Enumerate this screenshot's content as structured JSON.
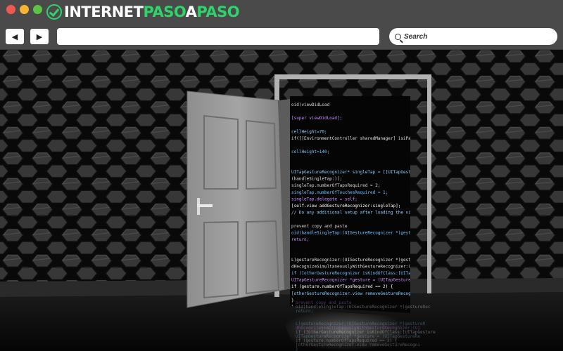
{
  "browser": {
    "logo_part1": "INTERNET",
    "logo_part2": "PASO",
    "logo_part3": "A",
    "logo_part4": "PASO",
    "back_icon": "◀",
    "forward_icon": "▶",
    "search_placeholder": "Search"
  },
  "scene": {
    "code_lines": [
      "oid)viewDidLoad",
      "",
      "[super viewDidLoad];",
      "",
      "cellHeight=70;",
      "if([[EnvironmentController sharedManager] isiPad])",
      "",
      "    cellHeight=140;",
      "",
      "",
      "UITapGestureRecognizer* singleTap = [[UITapGestureReco",
      "  (handleSingleTap:)];",
      "singleTap.numberOfTapsRequired = 2;",
      "singleTap.numberOfTouchesRequired = 1;",
      "singleTap.delegate = self;",
      "[self.view addGestureRecognizer:singleTap];",
      "// Do any additional setup after loading the view from",
      "",
      "prevent copy and paste",
      "oid)handleSingleTap:(UIGestureRecognizer *)gestureRec",
      "return;",
      "",
      "",
      "L)gestureRecognizer:(UIGestureRecognizer *)gestureR",
      "dRecognizeSimultaneouslyWithGestureRecognizer:(UI",
      "if ([otherGestureRecognizer isKindOfClass:[UITapGesture",
      "  UITapGestureRecognizer *gesture = (UITapGestureRe",
      "  if (gesture.numberOfTapsRequired == 2) {",
      "    [otherGestureRecognizer.view removeGestureRecogni",
      "  }",
      "}"
    ]
  }
}
